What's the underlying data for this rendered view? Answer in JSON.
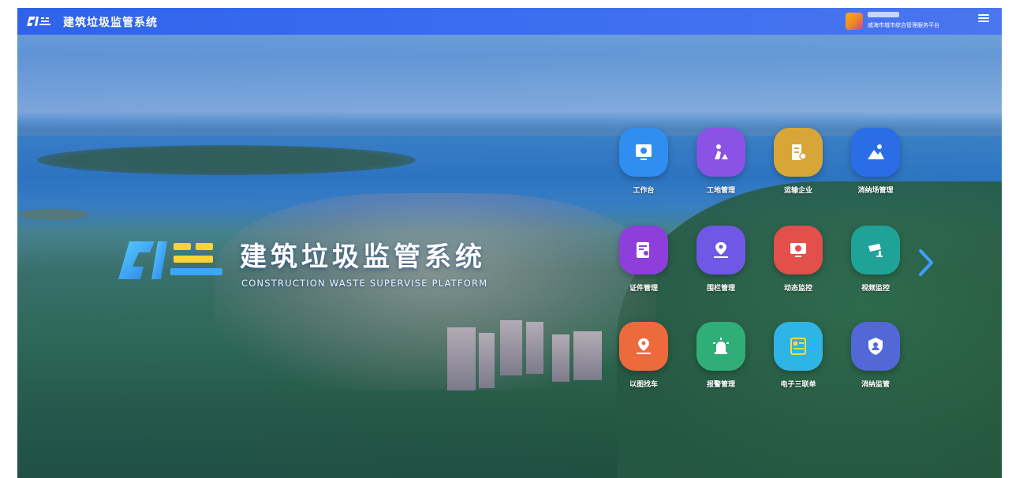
{
  "header": {
    "app_title": "建筑垃圾监管系统",
    "org_name": "威海市城市综合管理服务平台",
    "icons": {
      "logo": "brand-logo-icon",
      "avatar": "user-avatar",
      "menu": "hamburger-menu-icon"
    }
  },
  "hero": {
    "title": "建筑垃圾监管系统",
    "subtitle": "CONSTRUCTION WASTE SUPERVISE PLATFORM"
  },
  "tiles": [
    {
      "label": "工作台",
      "icon": "workbench-icon",
      "color": "#2f8ef0"
    },
    {
      "label": "工地管理",
      "icon": "construction-worker-icon",
      "color": "#8b52e6"
    },
    {
      "label": "运输企业",
      "icon": "enterprise-building-icon",
      "color": "#d7a637"
    },
    {
      "label": "消纳场管理",
      "icon": "landfill-location-icon",
      "color": "#2a6de6"
    },
    {
      "label": "证件管理",
      "icon": "certificate-icon",
      "color": "#8e3fdb"
    },
    {
      "label": "围栏管理",
      "icon": "fence-location-icon",
      "color": "#6f58e6"
    },
    {
      "label": "动态监控",
      "icon": "monitor-icon",
      "color": "#e34f4a"
    },
    {
      "label": "视频监控",
      "icon": "camera-icon",
      "color": "#1fa398"
    },
    {
      "label": "以图找车",
      "icon": "image-search-car-icon",
      "color": "#ec6a3c"
    },
    {
      "label": "报警管理",
      "icon": "alarm-light-icon",
      "color": "#2fae78"
    },
    {
      "label": "电子三联单",
      "icon": "e-form-icon",
      "color": "#2fb4e6"
    },
    {
      "label": "消纳监管",
      "icon": "shield-user-icon",
      "color": "#5168d6"
    }
  ],
  "nav": {
    "next_icon": "chevron-right-icon",
    "arrow_color": "#3da0ff"
  }
}
